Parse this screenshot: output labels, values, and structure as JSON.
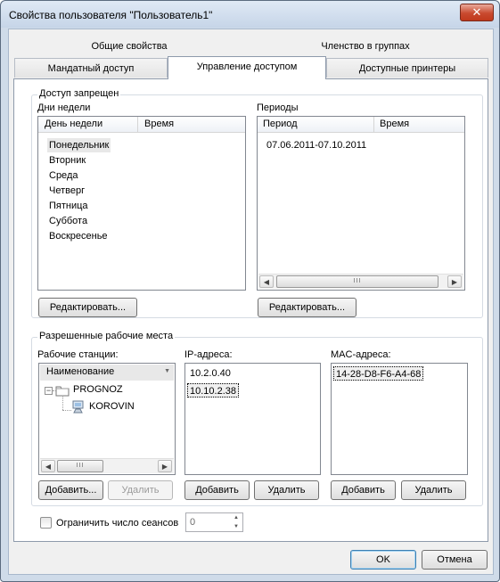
{
  "window": {
    "title": "Свойства пользователя \"Пользователь1\"",
    "close_glyph": "✕"
  },
  "tabs": {
    "row1": [
      "Общие свойства",
      "Членство в группах"
    ],
    "row2": [
      "Мандатный доступ",
      "Управление доступом",
      "Доступные принтеры"
    ],
    "active": "Управление доступом"
  },
  "access_denied": {
    "group_title": "Доступ запрещен",
    "days": {
      "label": "Дни недели",
      "columns": [
        "День недели",
        "Время"
      ],
      "items": [
        "Понедельник",
        "Вторник",
        "Среда",
        "Четверг",
        "Пятница",
        "Суббота",
        "Воскресенье"
      ],
      "edit_button": "Редактировать..."
    },
    "periods": {
      "label": "Периоды",
      "columns": [
        "Период",
        "Время"
      ],
      "items": [
        "07.06.2011-07.10.2011"
      ],
      "edit_button": "Редактировать..."
    }
  },
  "workplaces": {
    "group_title": "Разрешенные рабочие места",
    "stations": {
      "label": "Рабочие станции:",
      "column": "Наименование",
      "tree_root": "PROGNOZ",
      "tree_child": "KOROVIN",
      "add_button": "Добавить...",
      "remove_button": "Удалить"
    },
    "ip": {
      "label": "IP-адреса:",
      "items": [
        "10.2.0.40",
        "10.10.2.38"
      ],
      "add_button": "Добавить",
      "remove_button": "Удалить"
    },
    "mac": {
      "label": "MAC-адреса:",
      "items": [
        "14-28-D8-F6-A4-68"
      ],
      "add_button": "Добавить",
      "remove_button": "Удалить"
    }
  },
  "sessions": {
    "label": "Ограничить число сеансов",
    "checked": false,
    "value": "0"
  },
  "footer": {
    "ok": "OK",
    "cancel": "Отмена"
  },
  "icons": {
    "expander": "−",
    "scroll_left": "◀",
    "scroll_right": "▶",
    "thumb_grip": "III",
    "sort": "▼",
    "spin_up": "▲",
    "spin_down": "▼"
  }
}
